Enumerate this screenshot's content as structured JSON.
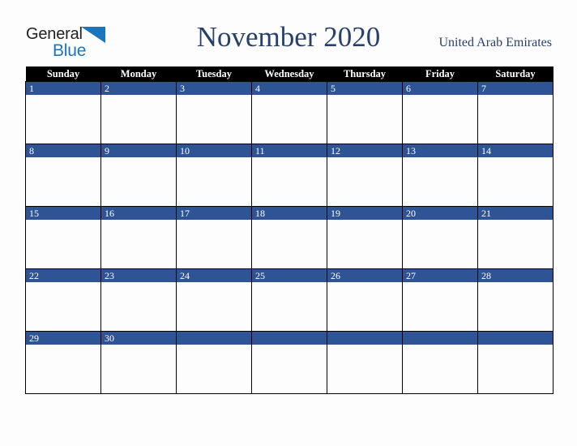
{
  "brand": {
    "name_part1": "General",
    "name_part2": "Blue",
    "triangle_color": "#1b75bc",
    "text_color": "#231f20"
  },
  "header": {
    "title": "November 2020",
    "country": "United Arab Emirates",
    "title_color": "#28416b"
  },
  "calendar": {
    "weekday_headers": [
      "Sunday",
      "Monday",
      "Tuesday",
      "Wednesday",
      "Thursday",
      "Friday",
      "Saturday"
    ],
    "header_bg": "#000000",
    "header_text": "#ffffff",
    "daynum_bg": "#2e5496",
    "daynum_text": "#ffffff",
    "cell_bg": "#fdfdfd",
    "grid_color": "#000000",
    "weeks": [
      [
        "1",
        "2",
        "3",
        "4",
        "5",
        "6",
        "7"
      ],
      [
        "8",
        "9",
        "10",
        "11",
        "12",
        "13",
        "14"
      ],
      [
        "15",
        "16",
        "17",
        "18",
        "19",
        "20",
        "21"
      ],
      [
        "22",
        "23",
        "24",
        "25",
        "26",
        "27",
        "28"
      ],
      [
        "29",
        "30",
        "",
        "",
        "",
        "",
        ""
      ]
    ]
  }
}
